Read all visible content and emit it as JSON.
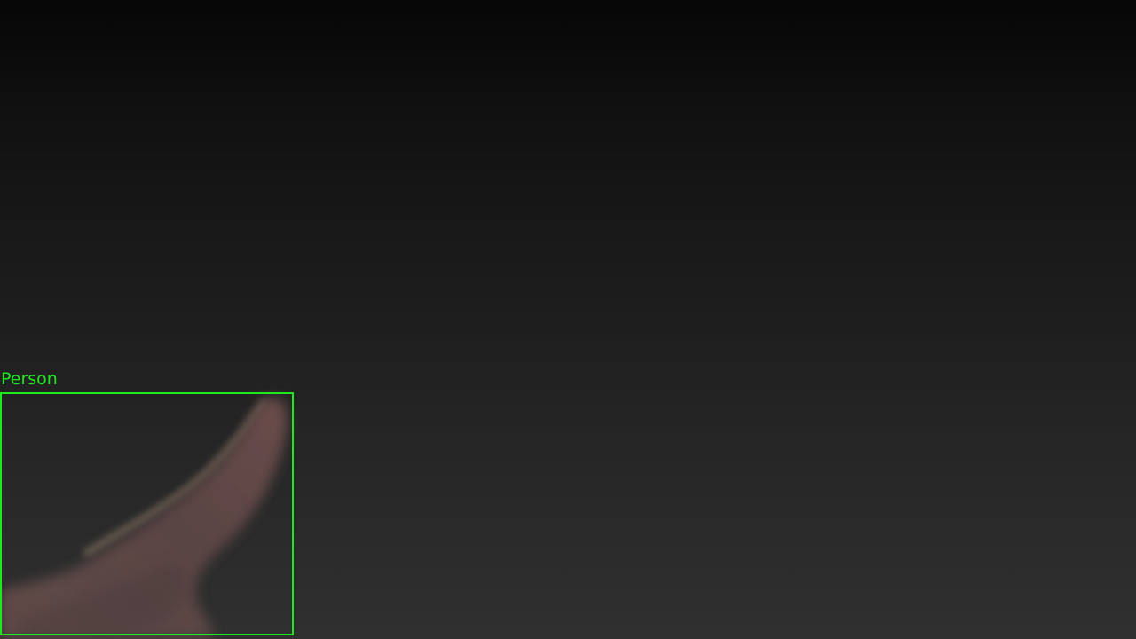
{
  "detections": [
    {
      "label": "Person",
      "box_color": "#1ee81e"
    }
  ],
  "colors": {
    "background_top": "#060606",
    "background_bottom": "#303030",
    "detection_green": "#1ee81e"
  }
}
